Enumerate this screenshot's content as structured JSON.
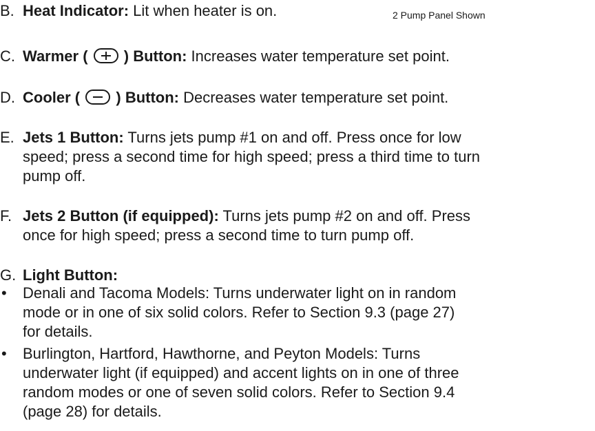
{
  "items": {
    "b": {
      "letter": "B.",
      "title": "Heat Indicator:",
      "text": " Lit when heater is on."
    },
    "caption": "2 Pump Panel Shown",
    "c": {
      "letter": "C.",
      "title_pre": "Warmer (",
      "title_post": ") Button:",
      "text": " Increases water temperature set point.",
      "icon": "plus-icon"
    },
    "d": {
      "letter": "D.",
      "title_pre": "Cooler (",
      "title_post": ") Button:",
      "text": " Decreases water temperature set point.",
      "icon": "minus-icon"
    },
    "e": {
      "letter": "E.",
      "title": "Jets 1 Button:",
      "line1": " Turns jets pump #1 on and off. Press once for low",
      "line2": "speed; press a second time for high speed; press a third time to turn",
      "line3": "pump off."
    },
    "f": {
      "letter": "F.",
      "title": "Jets 2 Button (if equipped):",
      "line1": " Turns jets pump #2 on and off. Press",
      "line2": "once for high speed; press a second time to turn pump off."
    },
    "g": {
      "letter": "G.",
      "title": "Light Button:",
      "bullet1": {
        "line1": "Denali and Tacoma Models: Turns underwater light on in random",
        "line2": "mode or in one of six solid colors. Refer to Section 9.3 (page 27)",
        "line3": "for details."
      },
      "bullet2": {
        "line1": "Burlington, Hartford, Hawthorne, and Peyton Models: Turns",
        "line2": "underwater light (if equipped) and accent lights on in one of three",
        "line3": "random modes or one of seven solid colors. Refer to Section 9.4",
        "line4": "(page 28) for details."
      },
      "bullet_char": "•"
    }
  }
}
